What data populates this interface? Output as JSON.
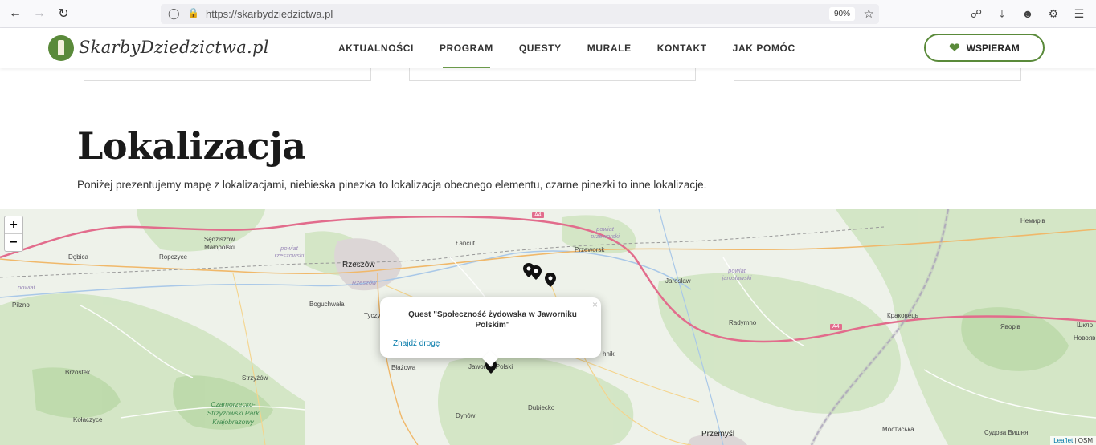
{
  "browser": {
    "url": "https://skarbydziedzictwa.pl",
    "zoom": "90%"
  },
  "site": {
    "logo_text": "SkarbyDziedzictwa.pl",
    "nav": [
      "AKTUALNOŚCI",
      "PROGRAM",
      "QUESTY",
      "MURALE",
      "KONTAKT",
      "JAK POMÓC"
    ],
    "active_nav": "PROGRAM",
    "cta_label": "WSPIERAM",
    "accent_color": "#5a8a3a"
  },
  "section": {
    "title": "Lokalizacja",
    "description": "Poniżej prezentujemy mapę z lokalizacjami, niebieska pinezka to lokalizacja obecnego elementu, czarne pinezki to inne lokalizacje."
  },
  "map": {
    "zoom_in": "+",
    "zoom_out": "−",
    "attribution_leaflet": "Leaflet",
    "attribution_rest": " | OSM",
    "popup": {
      "title": "Quest \"Społeczność żydowska w Jaworniku Polskim\"",
      "link": "Znajdź drogę",
      "close": "×"
    },
    "labels": {
      "debica": "Dębica",
      "sedziszow": "Sędziszów Małopolski",
      "ropczyce": "Ropczyce",
      "rzeszow": "Rzeszów",
      "rzeszow_region": "Rzeszów",
      "powiat_rzeszowski": "powiat rzeszowski",
      "powiat_debicki": "powiat",
      "lancut": "Łańcut",
      "przeworsk": "Przeworsk",
      "powiat_przeworski": "powiat przeworski",
      "jaroslaw": "Jarosław",
      "powiat_jaroslawski": "powiat jarosławski",
      "radymno": "Radymno",
      "krakowets": "Краковець",
      "nemyriv": "Немирів",
      "yavoriv": "Яворів",
      "shklo": "Шкло",
      "novoiavorivsk": "Новояв",
      "pilzno": "Pilzno",
      "boguchwala": "Boguchwała",
      "tyczyn": "Tyczy",
      "blazowa": "Błażowa",
      "jawornik": "Jawornik Polski",
      "hadle": "hnik",
      "brzostek": "Brzostek",
      "strzyzow": "Strzyżów",
      "park": "Czarnorzecko-Strzyżowski Park Krajobrazowy",
      "kolaczyce": "Kołaczyce",
      "dynow": "Dynów",
      "dubiecko": "Dubiecko",
      "przemysl": "Przemyśl",
      "mostyska": "Мостиська",
      "sudova": "Судова Вишня",
      "a4_west": "A4",
      "a4_east": "A4"
    }
  }
}
